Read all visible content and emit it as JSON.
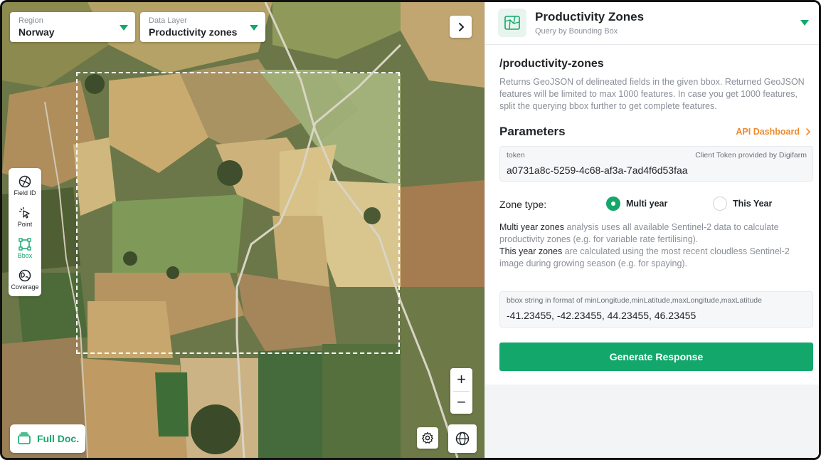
{
  "map": {
    "region": {
      "caption": "Region",
      "value": "Norway"
    },
    "data_layer": {
      "caption": "Data Layer",
      "value": "Productivity zones"
    },
    "tools": [
      {
        "label": "Field ID",
        "icon": "field-id-icon",
        "active": false
      },
      {
        "label": "Point",
        "icon": "pointer-icon",
        "active": false
      },
      {
        "label": "Bbox",
        "icon": "bbox-icon",
        "active": true
      },
      {
        "label": "Coverage",
        "icon": "coverage-icon",
        "active": false
      }
    ],
    "zoom_in": "+",
    "zoom_out": "−",
    "full_doc": "Full Doc."
  },
  "panel": {
    "title": "Productivity Zones",
    "subtitle": "Query by Bounding Box",
    "endpoint": "/productivity-zones",
    "description": "Returns GeoJSON of delineated fields in the given bbox. Returned GeoJSON features will be limited to max 1000 features. In case you get 1000 features, split the querying bbox further to get complete features.",
    "parameters_title": "Parameters",
    "api_dashboard": "API Dashboard",
    "token": {
      "label": "token",
      "hint": "Client Token provided by Digifarm",
      "value": "a0731a8c-5259-4c68-af3a-7ad4f6d53faa"
    },
    "zone_type": {
      "label": "Zone type:",
      "options": [
        {
          "label": "Multi year",
          "selected": true
        },
        {
          "label": "This Year",
          "selected": false
        }
      ]
    },
    "explain": {
      "multi_term": "Multi year zones",
      "multi_text": " analysis uses all available Sentinel-2 data to calculate productivity zones (e.g. for variable rate fertilising).",
      "this_term": "This year zones",
      "this_text": " are calculated using the most recent cloudless Sentinel-2 image during growing season (e.g. for spaying)."
    },
    "bbox": {
      "label": "bbox string in format of minLongitude,minLatitude,maxLongitude,maxLatitude",
      "value": "-41.23455, -42.23455, 44.23455, 46.23455"
    },
    "generate": "Generate Response"
  },
  "colors": {
    "accent": "#14a76c",
    "link": "#ee8b2c",
    "muted_text": "#8a8f98"
  }
}
